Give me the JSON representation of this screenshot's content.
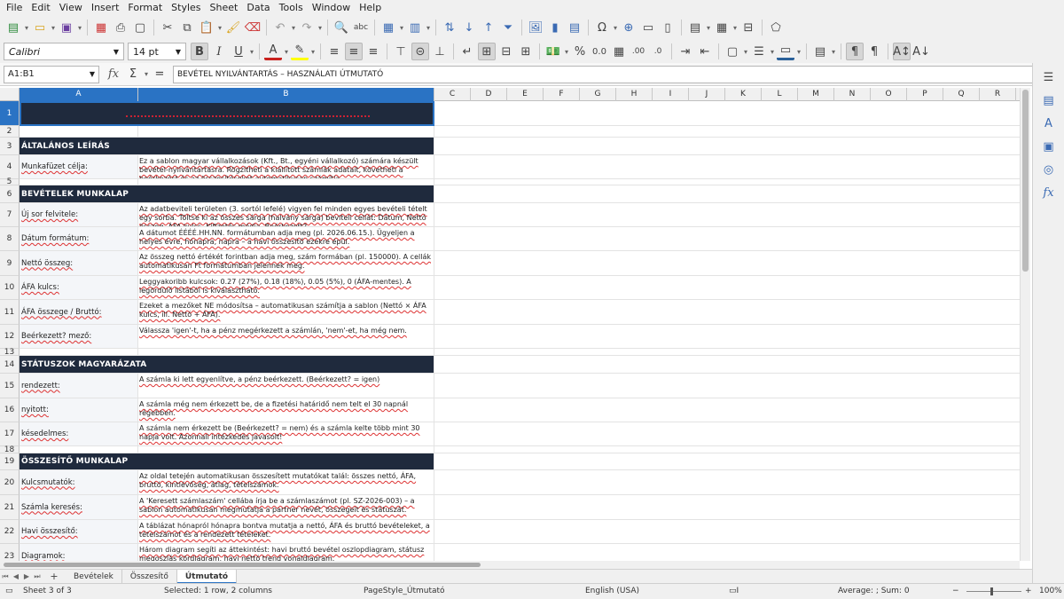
{
  "menu": [
    "File",
    "Edit",
    "View",
    "Insert",
    "Format",
    "Styles",
    "Sheet",
    "Data",
    "Tools",
    "Window",
    "Help"
  ],
  "toolbar": {
    "font_name": "Calibri",
    "font_size": "14 pt"
  },
  "formula_bar": {
    "name_box": "A1:B1",
    "fx": "fx",
    "sigma": "Σ",
    "equals": "=",
    "content": "BEVÉTEL NYILVÁNTARTÁS – HASZNÁLATI ÚTMUTATÓ"
  },
  "columns": [
    "A",
    "B",
    "C",
    "D",
    "E",
    "F",
    "G",
    "H",
    "I",
    "J",
    "K",
    "L",
    "M",
    "N",
    "O",
    "P",
    "Q",
    "R"
  ],
  "rows": [
    {
      "n": "1",
      "type": "title",
      "h": 28
    },
    {
      "n": "2",
      "type": "blank",
      "h": 13
    },
    {
      "n": "3",
      "type": "section",
      "h": 20,
      "a": "ÁLTALÁNOS LEÍRÁS"
    },
    {
      "n": "4",
      "type": "item",
      "h": 27,
      "a": "Munkafüzet célja:",
      "b": "Ez a sablon magyar vállalkozások (Kft., Bt., egyéni vállalkozó) számára készült bevétel-nyilvántartásra. Rögzítheti a kiállított számlák adatait, követheti a beérkezést és az összesítéseket automatikusan számítja."
    },
    {
      "n": "5",
      "type": "blank",
      "h": 7
    },
    {
      "n": "6",
      "type": "section",
      "h": 20,
      "a": "BEVÉTELEK MUNKALAP"
    },
    {
      "n": "7",
      "type": "item",
      "h": 27,
      "a": "Új sor felvitele:",
      "b": "Az adatbeviteli területen (3. sortól lefelé) vigyen fel minden egyes bevételi tételt egy sorba. Töltse ki az összes sárga (halvány sárga) beviteli cellát: Dátum, Nettó összeg, ÁFA kulcs, Kifizetés módja, Beérkezett?."
    },
    {
      "n": "8",
      "type": "item",
      "h": 27,
      "a": "Dátum formátum:",
      "b": "A dátumot ÉÉÉÉ.HH.NN. formátumban adja meg (pl. 2026.06.15.). Ügyeljen a helyes évre, hónapra, napra – a havi összesítő ezekre épül."
    },
    {
      "n": "9",
      "type": "item",
      "h": 28,
      "a": "Nettó összeg:",
      "b": "Az összeg nettó értékét forintban adja meg, szám formában (pl. 150000). A cellák automatikusan Ft formátumban jelennek meg."
    },
    {
      "n": "10",
      "type": "item",
      "h": 27,
      "a": "ÁFA kulcs:",
      "b": "Leggyakoribb kulcsok: 0.27 (27%), 0.18 (18%), 0.05 (5%), 0 (ÁFA-mentes). A legördülő listából is kiválasztható."
    },
    {
      "n": "11",
      "type": "item",
      "h": 28,
      "a": "ÁFA összege / Bruttó:",
      "b": "Ezeket a mezőket NE módosítsa – automatikusan számítja a sablon (Nettó × ÁFA kulcs, ill. Nettó + ÁFA)."
    },
    {
      "n": "12",
      "type": "item",
      "h": 27,
      "a": "Beérkezett? mező:",
      "b": "Válassza 'igen'-t, ha a pénz megérkezett a számlán, 'nem'-et, ha még nem."
    },
    {
      "n": "13",
      "type": "blank",
      "h": 8
    },
    {
      "n": "14",
      "type": "section",
      "h": 20,
      "a": "STÁTUSZOK MAGYARÁZATA"
    },
    {
      "n": "15",
      "type": "item",
      "h": 28,
      "a": "rendezett:",
      "b": "A számla ki lett egyenlítve, a pénz beérkezett. (Beérkezett? = igen)"
    },
    {
      "n": "16",
      "type": "item",
      "h": 27,
      "a": "nyitott:",
      "b": "A számla még nem érkezett be, de a fizetési határidő nem telt el 30 napnál régebben."
    },
    {
      "n": "17",
      "type": "item",
      "h": 27,
      "a": "késedelmes:",
      "b": "A számla nem érkezett be (Beérkezett? = nem) és a számla kelte több mint 30 napja volt. Azonnali intézkedés javasolt!"
    },
    {
      "n": "18",
      "type": "blank",
      "h": 8
    },
    {
      "n": "19",
      "type": "section",
      "h": 19,
      "a": "ÖSSZESÍTŐ MUNKALAP"
    },
    {
      "n": "20",
      "type": "item",
      "h": 28,
      "a": "Kulcsmutatók:",
      "b": "Az oldal tetején automatikusan összesített mutatókat talál: összes nettó, ÁFA, bruttó, kintlévőség, átlag, tételszámok."
    },
    {
      "n": "21",
      "type": "item",
      "h": 28,
      "a": "Számla keresés:",
      "b": "A 'Keresett számlaszám' cellába írja be a számlaszámot (pl. SZ-2026-003) – a sablon automatikusan megmutatja a partner nevét, összegeit és státuszát."
    },
    {
      "n": "22",
      "type": "item",
      "h": 27,
      "a": "Havi összesítő:",
      "b": "A táblázat hónapról hónapra bontva mutatja a nettó, ÁFA és bruttó bevételeket, a tételszámot és a rendezett tételeket."
    },
    {
      "n": "23",
      "type": "item",
      "h": 28,
      "a": "Diagramok:",
      "b": "Három diagram segíti az áttekintést: havi bruttó bevétel oszlopdiagram, státusz megoszlás kördiagram, havi nettó trend vonaldiagram."
    }
  ],
  "tabs": [
    "Bevételek",
    "Összesítő",
    "Útmutató"
  ],
  "status": {
    "sheet": "Sheet 3 of 3",
    "selection": "Selected: 1 row, 2 columns",
    "page_style": "PageStyle_Útmutató",
    "language": "English (USA)",
    "summary": "Average: ; Sum: 0",
    "zoom": "100%"
  }
}
